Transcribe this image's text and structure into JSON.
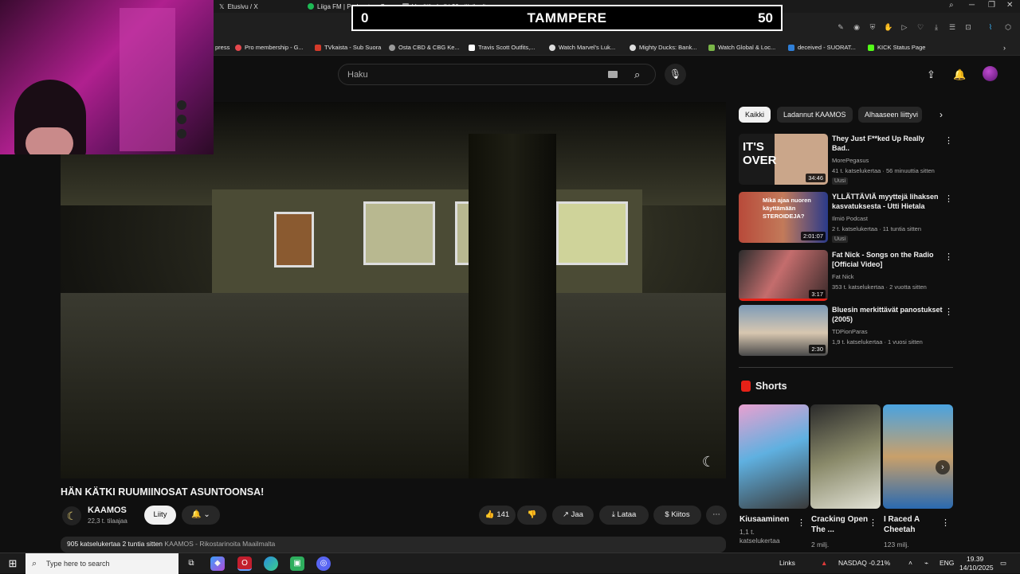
{
  "browser": {
    "tabs": [
      {
        "label": "Etusivu / X",
        "icon": "x-logo-icon"
      },
      {
        "label": "Liiga FM | Podcast on Sp",
        "icon": "spotify-icon"
      },
      {
        "label": "Venäjän halki 30 päivässä",
        "icon": "page-icon"
      }
    ],
    "bookmarks": [
      {
        "label": "press"
      },
      {
        "label": "Pro membership - G...",
        "color": "#e5484d"
      },
      {
        "label": "TVkaista - Sub Suora",
        "color": "#d43a2a"
      },
      {
        "label": "Osta CBD & CBG Ke...",
        "color": "#9a9a9a"
      },
      {
        "label": "Travis Scott Outfits,...",
        "color": "#ffffff"
      },
      {
        "label": "Watch Marvel's Luk...",
        "color": "#dddddd"
      },
      {
        "label": "Mighty Ducks: Bank...",
        "color": "#dddddd"
      },
      {
        "label": "Watch Global & Loc...",
        "color": "#7ab648"
      },
      {
        "label": "deceived - SUORAT...",
        "color": "#2f7fd8"
      },
      {
        "label": "KICK Status Page",
        "color": "#53fc18"
      }
    ]
  },
  "scoreboard": {
    "left_score": "0",
    "team": "TAMMPERE",
    "right_score": "50"
  },
  "youtube": {
    "search_placeholder": "Haku",
    "video": {
      "title": "HÄN KÄTKI RUUMIINOSAT ASUNTOONSA!",
      "channel": "KAAMOS",
      "subscribers": "22,3 t. tilaajaa",
      "join_label": "Liity",
      "likes": "141",
      "share_label": "Jaa",
      "download_label": "Lataa",
      "thanks_label": "Kiitos",
      "views_time": "905 katselukertaa  2 tuntia sitten",
      "tags": "KAAMOS - Rikostarinoita Maailmalta"
    },
    "chips": [
      "Kaikki",
      "Ladannut KAAMOS",
      "Alhaaseen liittyvi"
    ],
    "recommendations": [
      {
        "title": "They Just F**ked Up Really Bad..",
        "channel": "MorePegasus",
        "meta": "41 t. katselukertaa · 56 minuuttia sitten",
        "badge": "Uusi",
        "duration": "34:46",
        "thumb_text": "IT'S OVER"
      },
      {
        "title": "YLLÄTTÄVIÄ myyttejä lihaksen kasvatuksesta - Utti Hietala",
        "channel": "Ilmiö Podcast",
        "meta": "2 t. katselukertaa · 11 tuntia sitten",
        "badge": "Uusi",
        "duration": "2:01:07",
        "thumb_text": "Mikä ajaa nuoren käyttämään STEROIDEJA?"
      },
      {
        "title": "Fat Nick - Songs on the Radio [Official Video]",
        "channel": "Fat Nick",
        "meta": "353 t. katselukertaa · 2 vuotta sitten",
        "badge": "",
        "duration": "3:17",
        "thumb_text": ""
      },
      {
        "title": "Bluesin merkittävät panostukset (2005)",
        "channel": "TDPionParas",
        "meta": "1,9 t. katselukertaa · 1 vuosi sitten",
        "badge": "",
        "duration": "2:30",
        "thumb_text": ""
      }
    ],
    "shorts_heading": "Shorts",
    "shorts": [
      {
        "title": "Kiusaaminen",
        "views": "1,1 t. katselukertaa"
      },
      {
        "title": "Cracking Open The ...",
        "views": "2 milj."
      },
      {
        "title": "I Raced A Cheetah",
        "views": "123 milj."
      }
    ]
  },
  "taskbar": {
    "search_placeholder": "Type here to search",
    "links_label": "Links",
    "stock": "NASDAQ  -0.21%",
    "language": "ENG",
    "time": "19.39",
    "date": "14/10/2025"
  }
}
